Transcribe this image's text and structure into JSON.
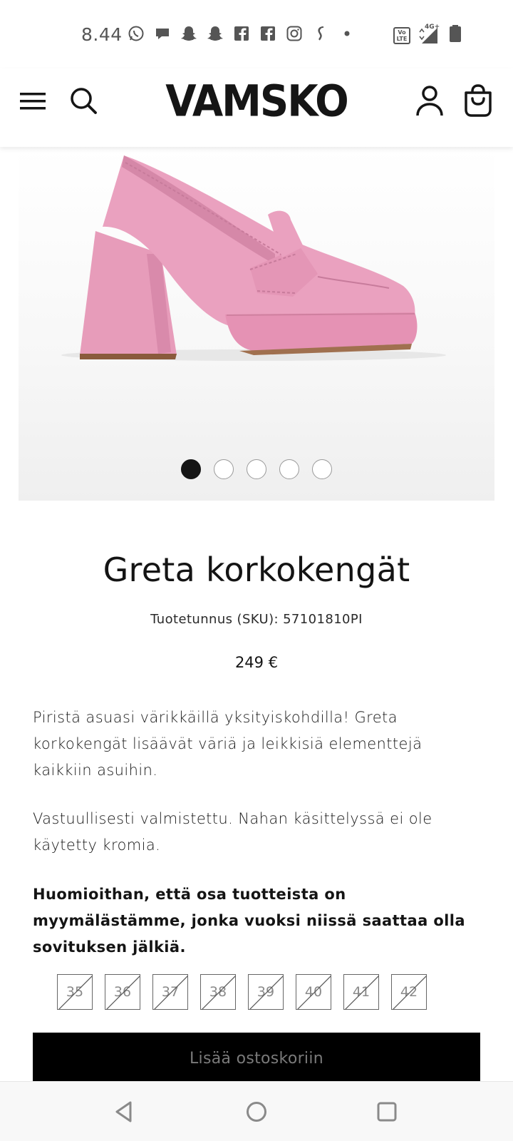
{
  "status_bar": {
    "time": "8.44",
    "notification_icons": [
      "whatsapp-icon",
      "messages-icon",
      "snapchat-icon",
      "snapchat-icon",
      "facebook-icon",
      "facebook-icon",
      "instagram-icon",
      "s-app-icon",
      "dot-icon"
    ],
    "right_icons": [
      "volte-icon",
      "4g-signal-icon",
      "battery-icon"
    ],
    "volte_label": "Vo LTE",
    "network_label": "4G+"
  },
  "header": {
    "logo": "VAMSKO",
    "menu_icon": "hamburger-menu-icon",
    "search_icon": "search-icon",
    "account_icon": "account-icon",
    "cart_icon": "shopping-bag-icon"
  },
  "gallery": {
    "image_description_icon": "pink-loafer-heel-image",
    "slides": 5,
    "active_slide": 1,
    "shoe_color": "#eaa1bf"
  },
  "product": {
    "title": "Greta korkokengät",
    "sku": "Tuotetunnus (SKU): 57101810PI",
    "price": "249 €",
    "description_1": "Piristä asuasi värikkäillä yksityiskohdilla! Greta korkokengät lisäävät väriä ja leikkisiä elementtejä kaikkiin asuihin.",
    "description_2": "Vastuullisesti valmistettu. Nahan käsittelyssä ei ole käytetty kromia.",
    "description_3": "Huomioithan, että osa tuotteista on myymälästämme, jonka vuoksi niissä saattaa olla sovituksen jälkiä.",
    "sizes": [
      {
        "label": "35",
        "available": false
      },
      {
        "label": "36",
        "available": false
      },
      {
        "label": "37",
        "available": false
      },
      {
        "label": "38",
        "available": false
      },
      {
        "label": "39",
        "available": false
      },
      {
        "label": "40",
        "available": false
      },
      {
        "label": "41",
        "available": false
      },
      {
        "label": "42",
        "available": false
      }
    ],
    "add_to_cart": "Lisää ostoskoriin"
  },
  "navbar": {
    "back_icon": "back-triangle-icon",
    "home_icon": "home-circle-icon",
    "recents_icon": "recents-square-icon"
  }
}
